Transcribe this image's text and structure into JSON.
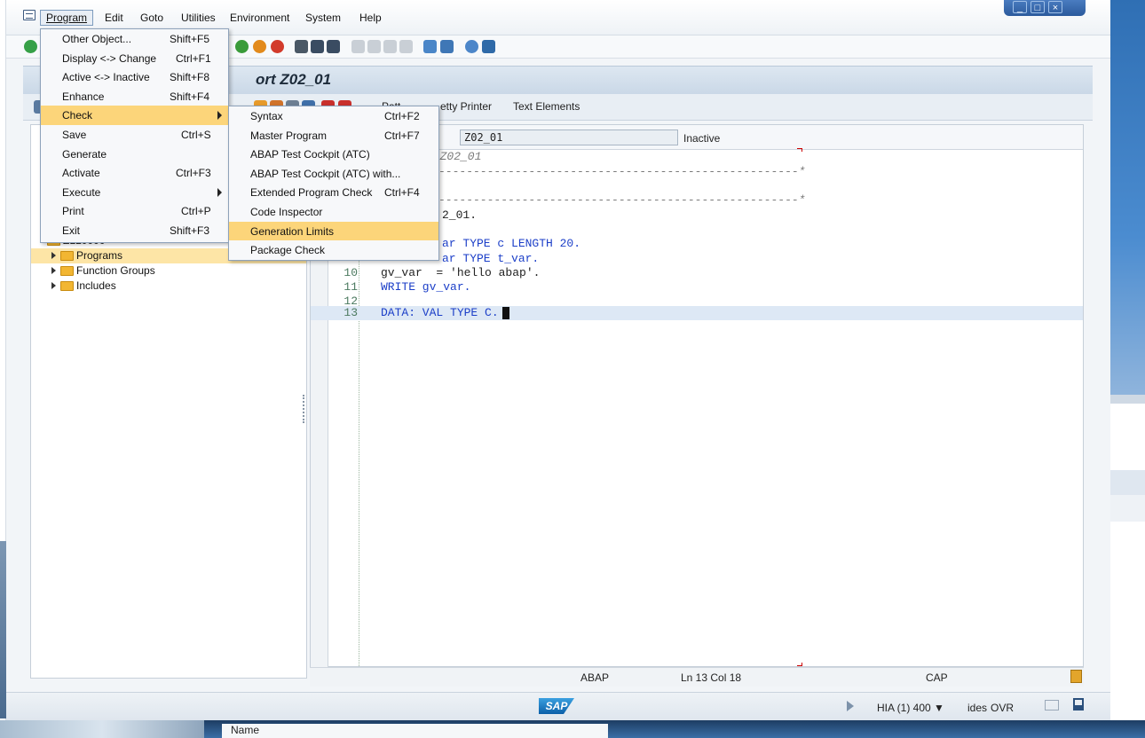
{
  "menubar": {
    "items": [
      "Program",
      "Edit",
      "Goto",
      "Utilities",
      "Environment",
      "System",
      "Help"
    ]
  },
  "title": {
    "text": "ort Z02_01"
  },
  "app_toolbar": {
    "pattern_partial": "Patt",
    "pretty_printer_partial": "etty Printer",
    "text_elements": "Text Elements"
  },
  "program_menu": {
    "items": [
      {
        "label": "Other Object...",
        "shortcut": "Shift+F5"
      },
      {
        "label": "Display <-> Change",
        "shortcut": "Ctrl+F1"
      },
      {
        "label": "Active <-> Inactive",
        "shortcut": "Shift+F8"
      },
      {
        "label": "Enhance",
        "shortcut": "Shift+F4"
      },
      {
        "label": "Check",
        "shortcut": ""
      },
      {
        "label": "Save",
        "shortcut": "Ctrl+S"
      },
      {
        "label": "Generate",
        "shortcut": ""
      },
      {
        "label": "Activate",
        "shortcut": "Ctrl+F3"
      },
      {
        "label": "Execute",
        "shortcut": ""
      },
      {
        "label": "Print",
        "shortcut": "Ctrl+P"
      },
      {
        "label": "Exit",
        "shortcut": "Shift+F3"
      }
    ]
  },
  "check_submenu": {
    "items": [
      {
        "label": "Syntax",
        "shortcut": "Ctrl+F2"
      },
      {
        "label": "Master Program",
        "shortcut": "Ctrl+F7"
      },
      {
        "label": "ABAP Test Cockpit (ATC)",
        "shortcut": ""
      },
      {
        "label": "ABAP Test Cockpit (ATC) with...",
        "shortcut": ""
      },
      {
        "label": "Extended Program Check",
        "shortcut": "Ctrl+F4"
      },
      {
        "label": "Code Inspector",
        "shortcut": ""
      },
      {
        "label": "Generation Limits",
        "shortcut": ""
      },
      {
        "label": "Package Check",
        "shortcut": ""
      }
    ]
  },
  "tree": {
    "root_partial": "ZLL0000",
    "items": [
      "Programs",
      "Function Groups",
      "Includes"
    ]
  },
  "editor": {
    "program_name": "Z02_01",
    "status": "Inactive",
    "lines": [
      {
        "num": "",
        "text": ": Z02_01"
      },
      {
        "num": "",
        "text": "----------------------------------------------------*"
      },
      {
        "num": "",
        "text": ""
      },
      {
        "num": "",
        "text": "----------------------------------------------------*"
      },
      {
        "num": "",
        "text": "2_01."
      },
      {
        "num": "",
        "text": ""
      },
      {
        "num": "",
        "text": "ar TYPE c LENGTH 20."
      },
      {
        "num": "",
        "text": "ar TYPE t_var."
      },
      {
        "num": "10",
        "text": "gv_var  = 'hello abap'."
      },
      {
        "num": "11",
        "text": "WRITE gv_var."
      },
      {
        "num": "12",
        "text": ""
      },
      {
        "num": "13",
        "text": "DATA: VAL TYPE C."
      }
    ]
  },
  "editor_status": {
    "lang": "ABAP",
    "position": "Ln  13 Col  18",
    "caps": "CAP"
  },
  "statusbar": {
    "sap_logo": "SAP",
    "system": "HIA (1) 400",
    "host": "ides",
    "mode": "OVR"
  },
  "bottom": {
    "name_label": "Name"
  },
  "colors": {
    "menu_highlight": "#fcd57a",
    "tree_selection": "#fde5a6",
    "keyword": "#1c3fc8"
  }
}
